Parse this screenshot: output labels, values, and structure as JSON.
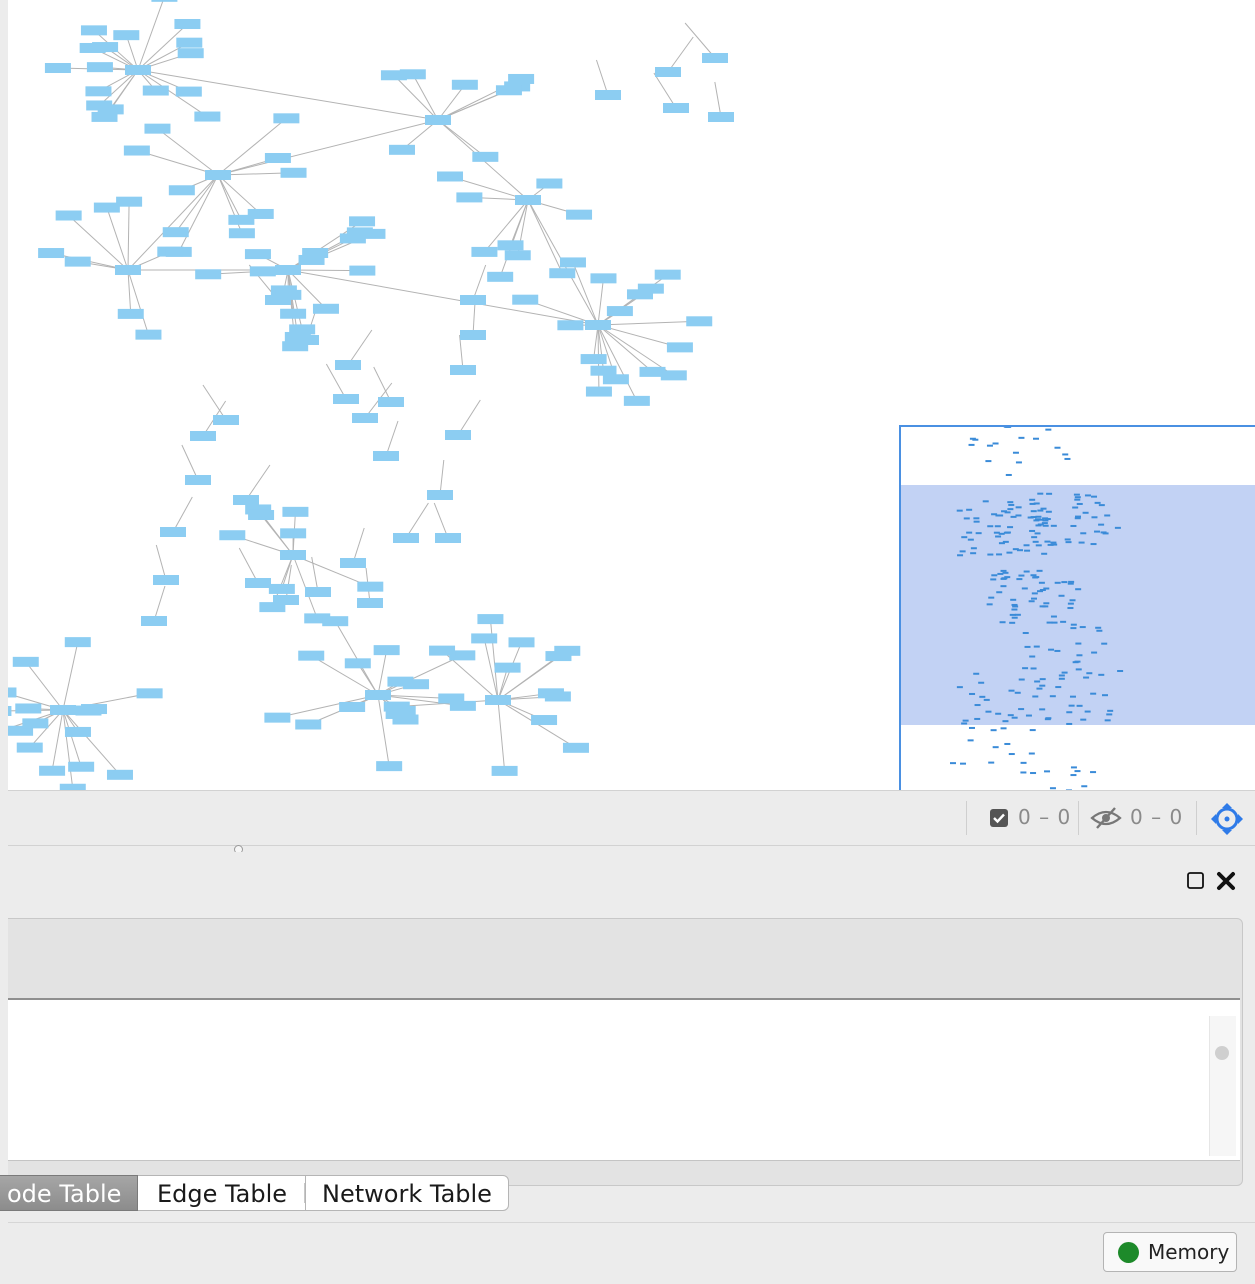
{
  "network_view": {
    "colors": {
      "node_fill": "#8ccdf2",
      "edge_stroke": "#b3b3b3",
      "navigator_border": "#4a90e2",
      "navigator_viewport": "#a8bff0"
    }
  },
  "toolbar": {
    "selected_stat": "0 – 0",
    "hidden_stat": "0 – 0",
    "icons": [
      "checkbox-icon",
      "hidden-eye-icon",
      "fit-content-icon"
    ]
  },
  "table_panel": {
    "icons": [
      "maximize-icon",
      "close-icon"
    ]
  },
  "tabs": {
    "node_table": "ode Table",
    "edge_table": "Edge Table",
    "network_table": "Network Table"
  },
  "status_bar": {
    "memory_label": "Memory",
    "memory_status_color": "#1d8a2a"
  }
}
